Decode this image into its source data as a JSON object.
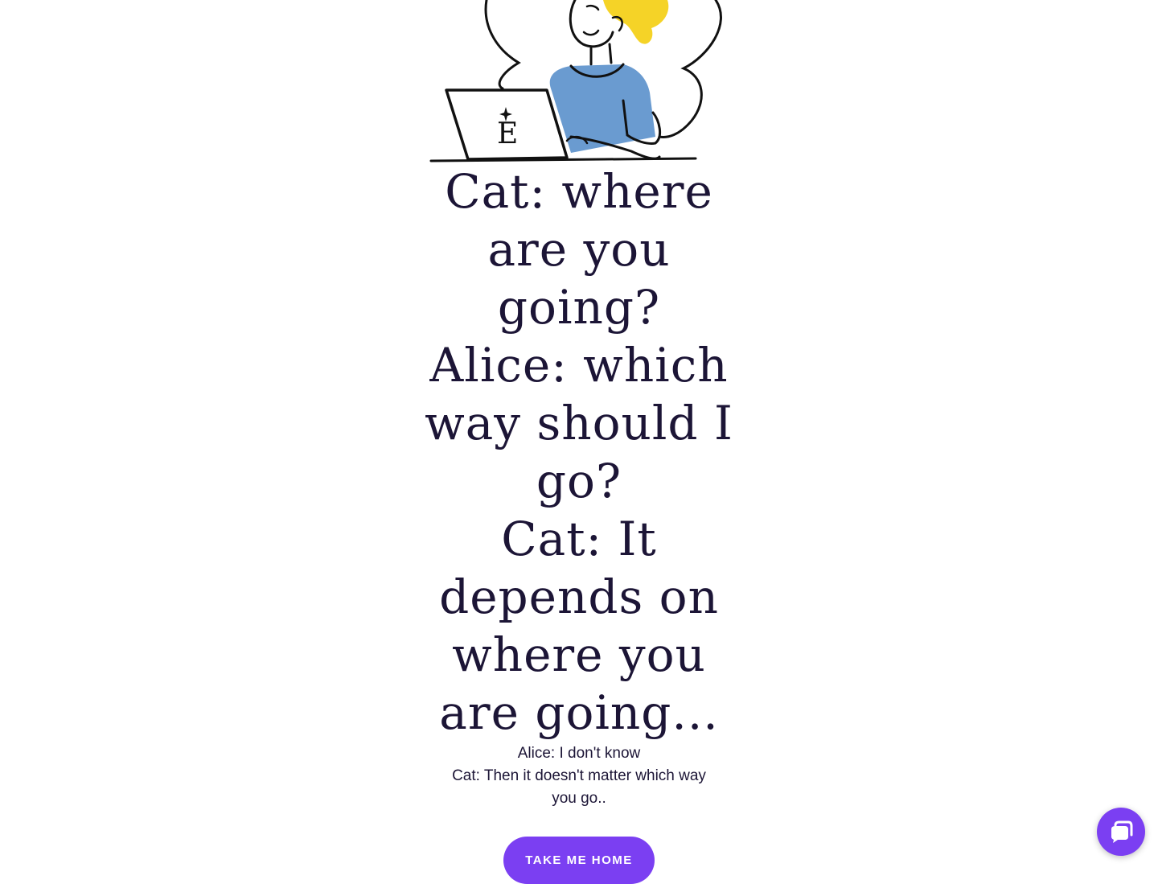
{
  "illustration": {
    "icon": "person-at-laptop-illustration",
    "laptop_logo": "Ė",
    "colors": {
      "hair": "#f5d327",
      "shirt": "#6a9bd0",
      "outline": "#111111"
    }
  },
  "headline": {
    "lines": [
      "Cat: where",
      "are you",
      "going?",
      "Alice: which",
      "way should I",
      "go?",
      "Cat: It",
      "depends on",
      "where you",
      "are going..."
    ]
  },
  "subtext": {
    "lines": [
      "Alice: I don't know",
      "Cat: Then it doesn't matter which way",
      "you go.."
    ]
  },
  "button": {
    "label": "TAKE ME HOME"
  },
  "chat": {
    "icon": "chat-bubble-icon"
  },
  "colors": {
    "accent": "#7b3ff2",
    "text": "#1c1536",
    "background": "#ffffff"
  }
}
